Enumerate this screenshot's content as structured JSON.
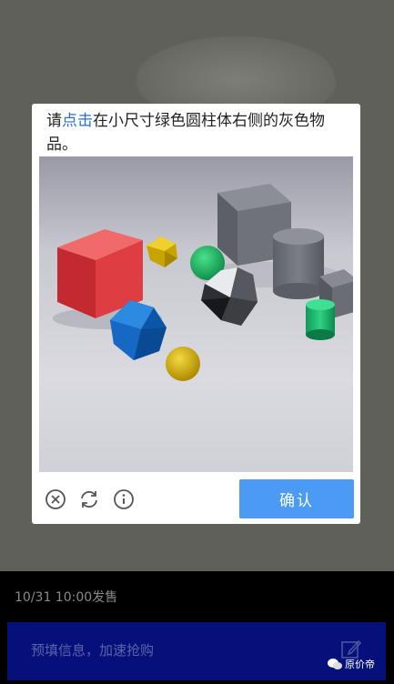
{
  "captcha_dialog": {
    "prompt_prefix": "请",
    "prompt_highlight": "点击",
    "prompt_rest": "在小尺寸绿色圆柱体右侧的灰色物品。",
    "confirm_label": "确认",
    "icons": [
      "close-circle-icon",
      "refresh-icon",
      "info-icon"
    ],
    "accent_color": "#4b9bf5"
  },
  "product": {
    "sale_time": "10/31 10:00发售"
  },
  "action_bar": {
    "label": "预填信息，加速抢购",
    "icon": "edit-icon",
    "color": "#05107a"
  },
  "watermark": {
    "text": "原价帝"
  }
}
